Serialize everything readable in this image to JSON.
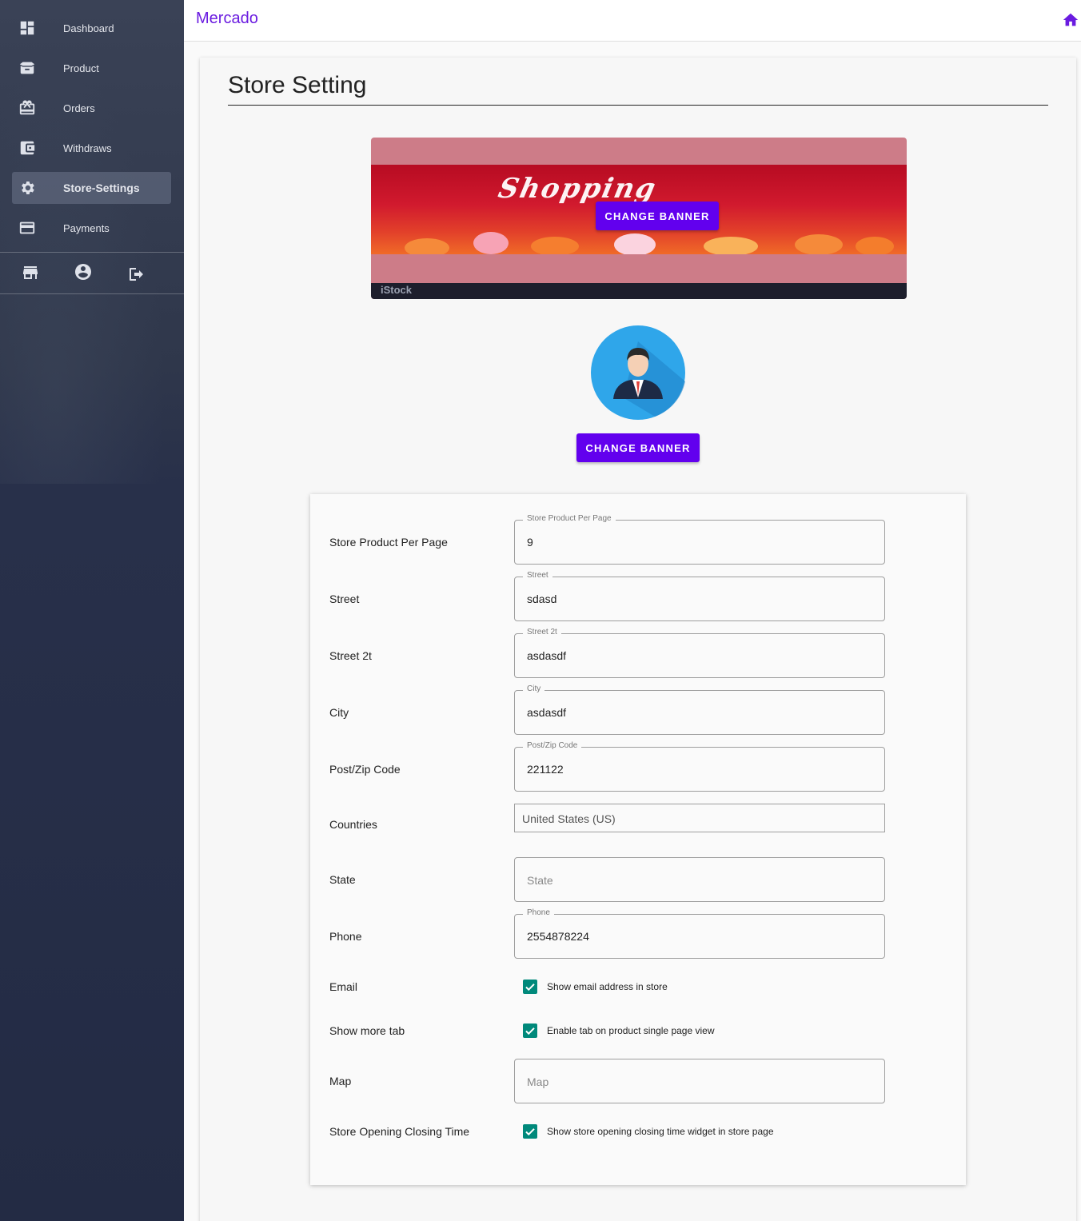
{
  "app": {
    "brand": "Mercado"
  },
  "sidebar": {
    "items": [
      {
        "label": "Dashboard",
        "icon": "dashboard-icon"
      },
      {
        "label": "Product",
        "icon": "box-icon"
      },
      {
        "label": "Orders",
        "icon": "gift-icon"
      },
      {
        "label": "Withdraws",
        "icon": "wallet-icon"
      },
      {
        "label": "Store-Settings",
        "icon": "gear-icon",
        "active": true
      },
      {
        "label": "Payments",
        "icon": "credit-card-icon"
      }
    ],
    "footer_icons": [
      "store-icon",
      "account-icon",
      "logout-icon"
    ]
  },
  "page": {
    "title": "Store Setting",
    "banner_text": "Shopping",
    "banner_watermark": "iStock",
    "change_banner_label": "CHANGE BANNER",
    "change_avatar_label": "CHANGE BANNER"
  },
  "form": {
    "store_product_per_page": {
      "label": "Store Product Per Page",
      "legend": "Store Product Per Page",
      "value": "9"
    },
    "street": {
      "label": "Street",
      "legend": "Street",
      "value": "sdasd"
    },
    "street2": {
      "label": "Street 2t",
      "legend": "Street 2t",
      "value": "asdasdf"
    },
    "city": {
      "label": "City",
      "legend": "City",
      "value": "asdasdf"
    },
    "zip": {
      "label": "Post/Zip Code",
      "legend": "Post/Zip Code",
      "value": "221122"
    },
    "countries": {
      "label": "Countries",
      "value": "United States (US)"
    },
    "state": {
      "label": "State",
      "placeholder": "State"
    },
    "phone": {
      "label": "Phone",
      "legend": "Phone",
      "value": "2554878224"
    },
    "email": {
      "label": "Email",
      "checkbox_label": "Show email address in store",
      "checked": true
    },
    "more_tab": {
      "label": "Show more tab",
      "checkbox_label": "Enable tab on product single page view",
      "checked": true
    },
    "map": {
      "label": "Map",
      "placeholder": "Map"
    },
    "opening_time": {
      "label": "Store Opening Closing Time",
      "checkbox_label": "Show store opening closing time widget in store page",
      "checked": true
    }
  },
  "colors": {
    "accent": "#6200ee",
    "brand": "#6a1be0",
    "checkbox": "#00897b",
    "sidebar": "#2a3248"
  }
}
